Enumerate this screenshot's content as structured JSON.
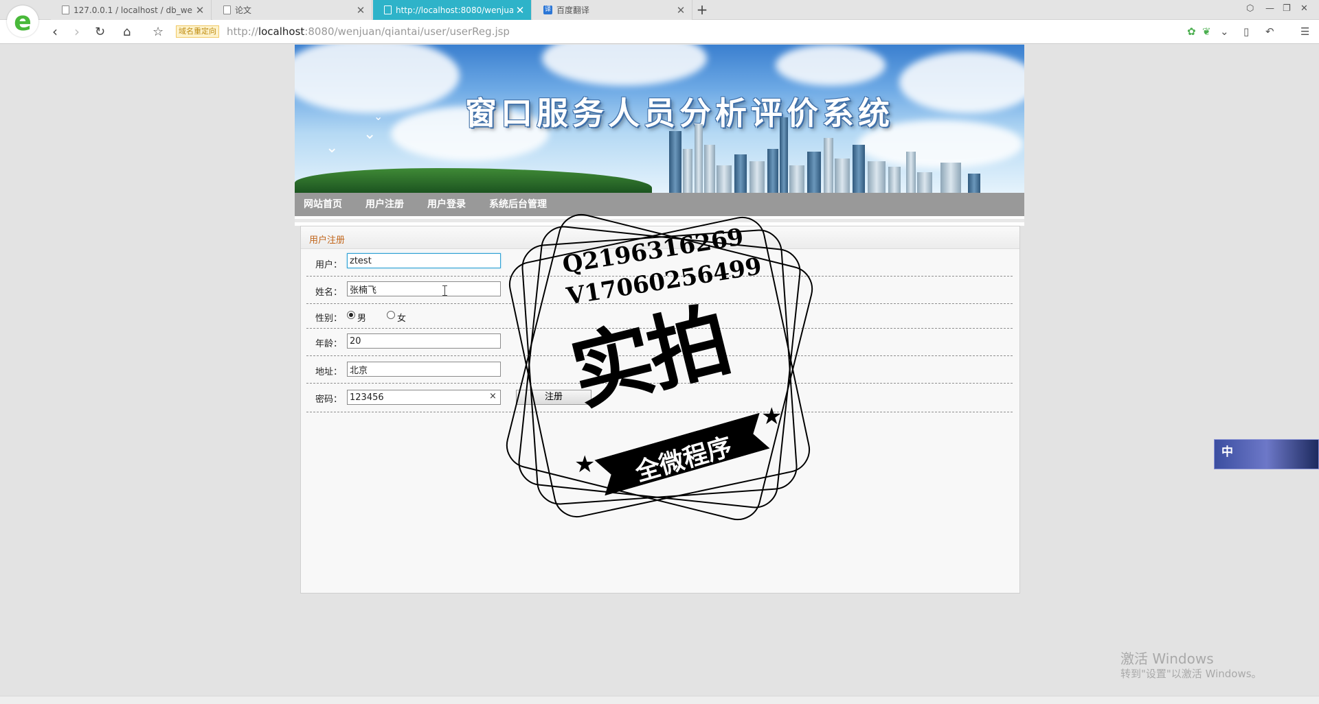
{
  "browser": {
    "tabs": [
      {
        "title": "127.0.0.1 / localhost / db_wenjuan"
      },
      {
        "title": "论文"
      },
      {
        "title": "http://localhost:8080/wenjuan/qiantai/user/userReg.jsp"
      },
      {
        "title": "百度翻译"
      }
    ],
    "new_tab": "+",
    "redirect_badge": "域名重定向",
    "url_prefix": "http://",
    "url_host": "localhost",
    "url_rest": ":8080/wenjuan/qiantai/user/userReg.jsp",
    "icon_colors": {
      "accent": "#2eb3c9",
      "brand": "#49b93a"
    }
  },
  "banner": {
    "title": "窗口服务人员分析评价系统"
  },
  "nav": {
    "items": [
      "网站首页",
      "用户注册",
      "用户登录",
      "系统后台管理"
    ]
  },
  "form": {
    "title": "用户注册",
    "user_label": "用户：",
    "user_value": "ztest",
    "name_label": "姓名：",
    "name_value": "张楠飞",
    "gender_label": "性别：",
    "gender_male": "男",
    "gender_female": "女",
    "gender_selected": "男",
    "age_label": "年龄：",
    "age_value": "20",
    "address_label": "地址：",
    "address_value": "北京",
    "password_label": "密码：",
    "password_value": "123456",
    "submit_label": "注册",
    "clear_glyph": "×"
  },
  "watermark": {
    "line1": "Q2196316269",
    "line2": "V17060256499",
    "big": "实拍",
    "ribbon": "全微程序"
  },
  "float_widget": {
    "label": "中"
  },
  "os": {
    "activate_title": "激活 Windows",
    "activate_hint": "转到\"设置\"以激活 Windows。"
  }
}
